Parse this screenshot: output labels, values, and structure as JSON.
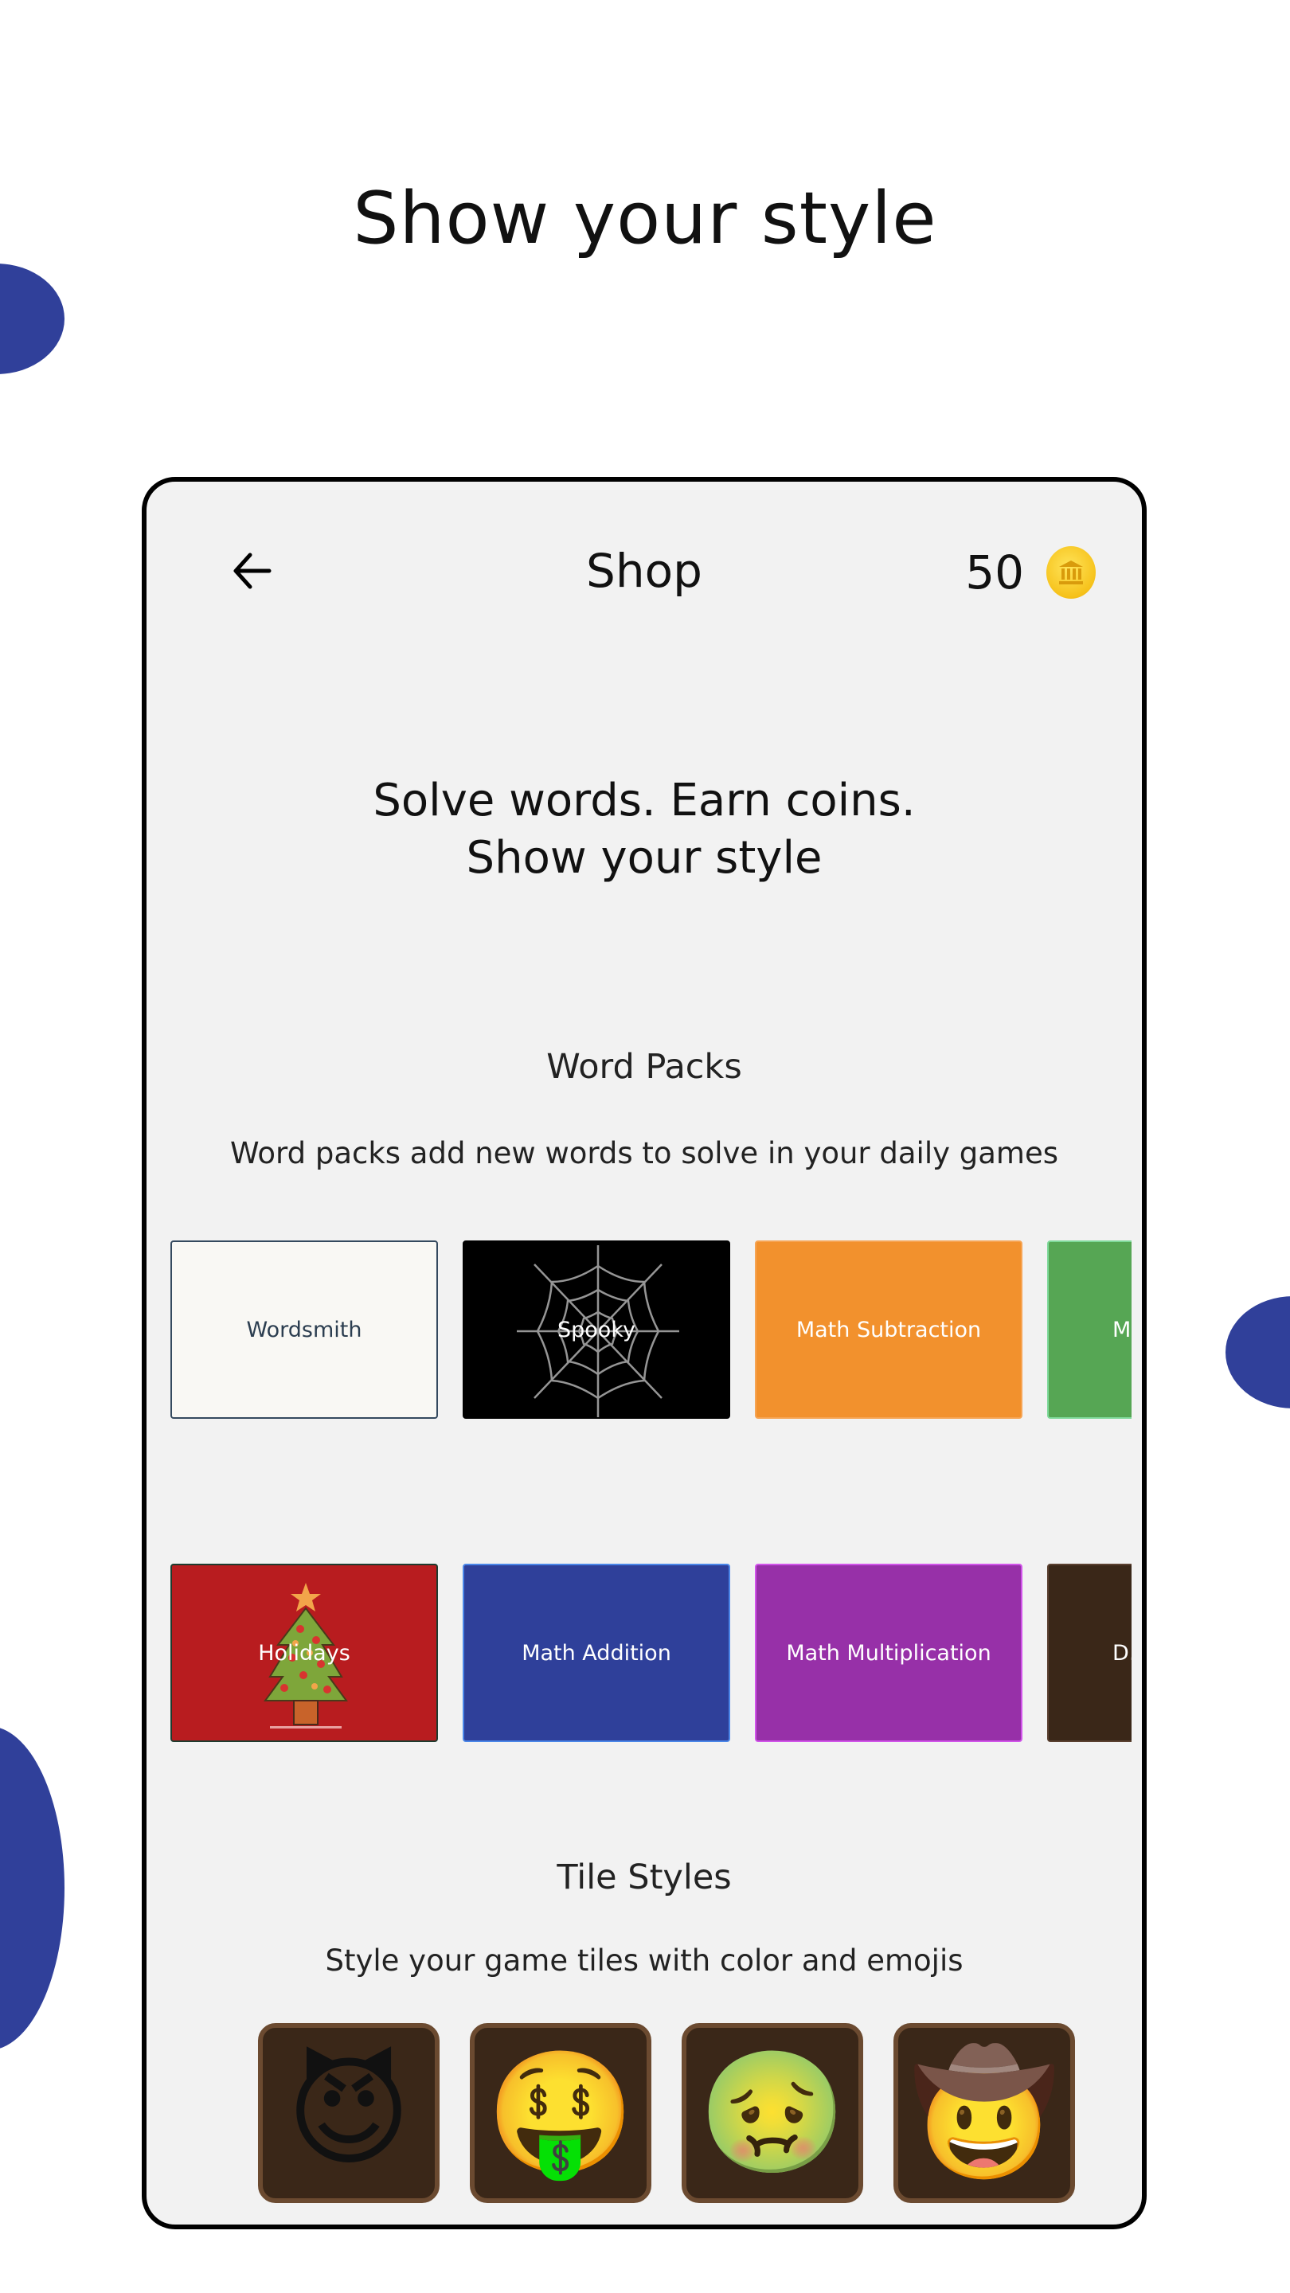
{
  "hero": {
    "title": "Show your style"
  },
  "header": {
    "back_icon": "arrow-left-icon",
    "title": "Shop",
    "coin_count": "50",
    "coin_icon": "coin-icon"
  },
  "tagline": {
    "line1": "Solve words. Earn coins.",
    "line2": "Show your style"
  },
  "word_packs": {
    "title": "Word Packs",
    "subtitle": "Word packs add new words to solve in your daily games",
    "row1": [
      {
        "label": "Wordsmith",
        "bg": "#f9f8f4",
        "border": "#34495e",
        "text_color": "#2c3e50"
      },
      {
        "label": "Spooky",
        "bg": "#000000",
        "border": "#000000",
        "text_color": "#ffffff",
        "art": "spider-web"
      },
      {
        "label": "Math Subtraction",
        "bg": "#f2912d",
        "border": "#f6a453",
        "text_color": "#ffffff"
      },
      {
        "label": "Math …",
        "bg": "#56a654",
        "border": "#7fd99a",
        "text_color": "#ffffff"
      }
    ],
    "row2": [
      {
        "label": "Holidays",
        "bg": "#b81c1f",
        "border": "#1e3b2e",
        "text_color": "#ffffff",
        "art": "christmas-tree"
      },
      {
        "label": "Math Addition",
        "bg": "#2f409a",
        "border": "#4a86e8",
        "text_color": "#ffffff"
      },
      {
        "label": "Math Multiplication",
        "bg": "#9730a8",
        "border": "#d154ea",
        "text_color": "#ffffff"
      },
      {
        "label": "D…",
        "bg": "#3a2718",
        "border": "#5a4030",
        "text_color": "#ffffff"
      }
    ]
  },
  "tile_styles": {
    "title": "Tile Styles",
    "subtitle": "Style your game tiles with color and emojis",
    "tiles": [
      {
        "emoji": "😈",
        "name": "smiling-devil"
      },
      {
        "emoji": "🤑",
        "name": "money-mouth-face"
      },
      {
        "emoji": "🤢",
        "name": "nauseated-face"
      },
      {
        "emoji": "🤠",
        "name": "cowboy-face"
      }
    ]
  },
  "colors": {
    "accent_blue": "#30409a",
    "phone_bg": "#f2f2f2"
  }
}
